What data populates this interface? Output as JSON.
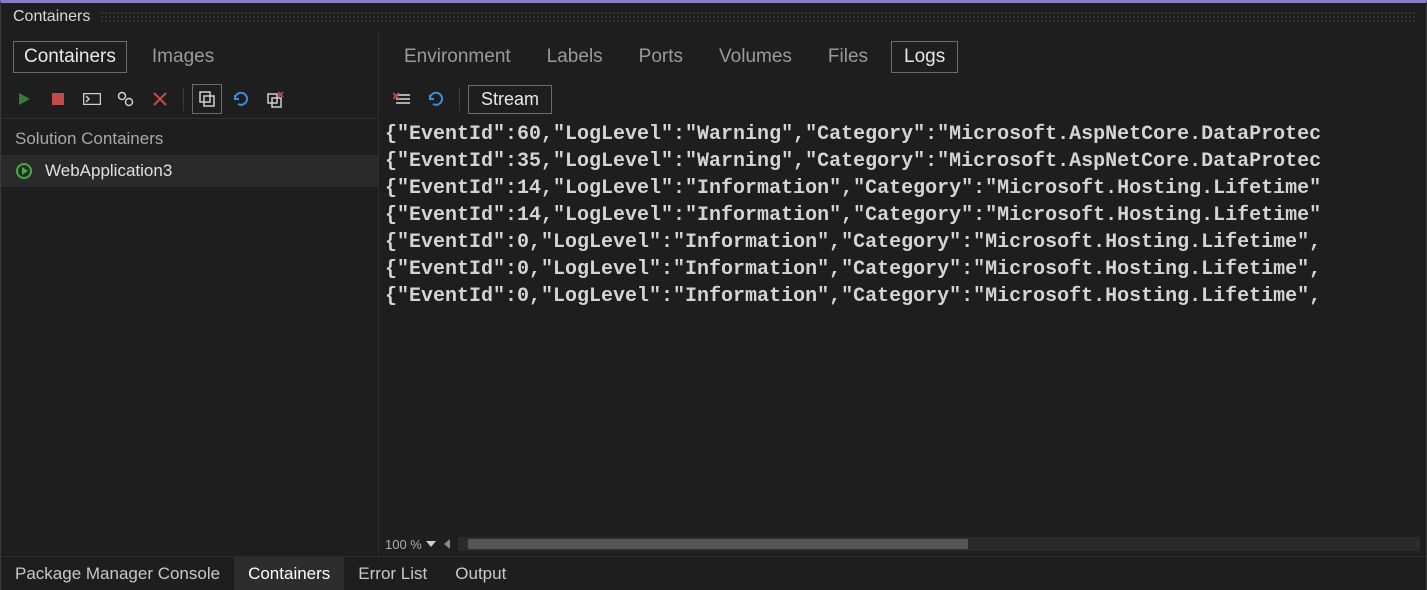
{
  "panel": {
    "title": "Containers"
  },
  "left": {
    "tabs": {
      "containers": "Containers",
      "images": "Images"
    },
    "heading": "Solution Containers",
    "items": [
      {
        "name": "WebApplication3",
        "running": true
      }
    ]
  },
  "detail": {
    "tabs": {
      "environment": "Environment",
      "labels": "Labels",
      "ports": "Ports",
      "volumes": "Volumes",
      "files": "Files",
      "logs": "Logs"
    },
    "stream_label": "Stream",
    "zoom": "100 %",
    "logs": [
      "{\"EventId\":60,\"LogLevel\":\"Warning\",\"Category\":\"Microsoft.AspNetCore.DataProtec",
      "{\"EventId\":35,\"LogLevel\":\"Warning\",\"Category\":\"Microsoft.AspNetCore.DataProtec",
      "{\"EventId\":14,\"LogLevel\":\"Information\",\"Category\":\"Microsoft.Hosting.Lifetime\"",
      "{\"EventId\":14,\"LogLevel\":\"Information\",\"Category\":\"Microsoft.Hosting.Lifetime\"",
      "{\"EventId\":0,\"LogLevel\":\"Information\",\"Category\":\"Microsoft.Hosting.Lifetime\",",
      "{\"EventId\":0,\"LogLevel\":\"Information\",\"Category\":\"Microsoft.Hosting.Lifetime\",",
      "{\"EventId\":0,\"LogLevel\":\"Information\",\"Category\":\"Microsoft.Hosting.Lifetime\","
    ]
  },
  "bottom": {
    "tabs": {
      "pmc": "Package Manager Console",
      "containers": "Containers",
      "errorlist": "Error List",
      "output": "Output"
    }
  }
}
